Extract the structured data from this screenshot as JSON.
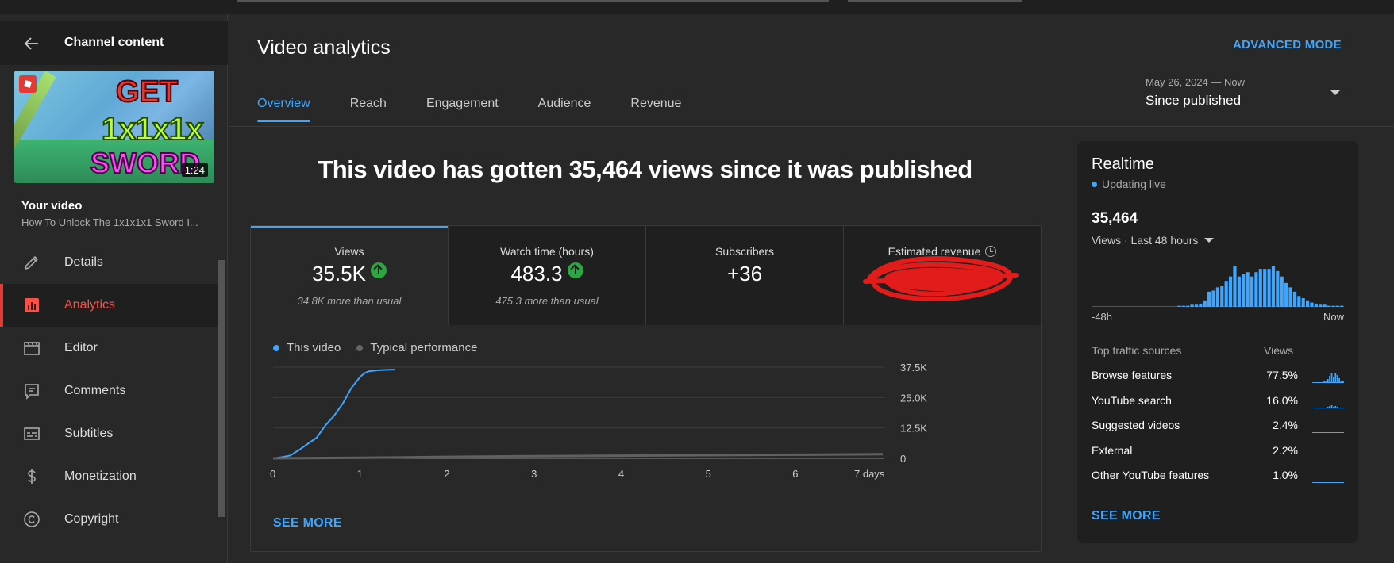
{
  "sidebar": {
    "title": "Channel content",
    "thumbnail": {
      "text_line1": "GET",
      "text_line2": "1x1x1x",
      "text_line3": "SWORD",
      "duration": "1:24"
    },
    "your_video_label": "Your video",
    "video_title": "How To Unlock The 1x1x1x1 Sword I...",
    "items": [
      {
        "label": "Details",
        "icon": "pencil-icon"
      },
      {
        "label": "Analytics",
        "icon": "analytics-icon",
        "active": true
      },
      {
        "label": "Editor",
        "icon": "clapperboard-icon"
      },
      {
        "label": "Comments",
        "icon": "comment-icon"
      },
      {
        "label": "Subtitles",
        "icon": "subtitles-icon"
      },
      {
        "label": "Monetization",
        "icon": "dollar-icon"
      },
      {
        "label": "Copyright",
        "icon": "copyright-icon"
      }
    ]
  },
  "header": {
    "title": "Video analytics",
    "advanced_mode": "ADVANCED MODE",
    "tabs": [
      "Overview",
      "Reach",
      "Engagement",
      "Audience",
      "Revenue"
    ],
    "date_range": "May 26, 2024 — Now",
    "date_label": "Since published"
  },
  "headline": "This video has gotten 35,464 views since it was published",
  "metrics": [
    {
      "label": "Views",
      "value": "35.5K",
      "note": "34.8K more than usual",
      "trend": "up"
    },
    {
      "label": "Watch time (hours)",
      "value": "483.3",
      "note": "475.3 more than usual",
      "trend": "up"
    },
    {
      "label": "Subscribers",
      "value": "+36",
      "note": ""
    },
    {
      "label": "Estimated revenue",
      "value": "",
      "note": "",
      "redacted": true
    }
  ],
  "chart_legend": {
    "this_video": "This video",
    "typical": "Typical performance"
  },
  "chart_data": {
    "type": "line",
    "x_ticks": [
      "0",
      "1",
      "2",
      "3",
      "4",
      "5",
      "6",
      "7 days"
    ],
    "y_ticks": [
      "37.5K",
      "25.0K",
      "12.5K",
      "0"
    ],
    "xlim": [
      0,
      7
    ],
    "ylim": [
      0,
      37500
    ],
    "series": [
      {
        "name": "This video",
        "color": "#3ea6ff",
        "x": [
          0,
          0.1,
          0.2,
          0.3,
          0.4,
          0.5,
          0.6,
          0.7,
          0.8,
          0.9,
          1.0,
          1.05,
          1.1,
          1.2,
          1.3,
          1.4
        ],
        "y": [
          0,
          500,
          1200,
          3500,
          6000,
          8500,
          13500,
          17500,
          22500,
          29000,
          33500,
          35000,
          35800,
          36200,
          36400,
          36500
        ]
      },
      {
        "name": "Typical performance",
        "color": "#606060",
        "x": [
          0,
          1,
          2,
          3,
          4,
          5,
          6,
          7
        ],
        "y": [
          0,
          250,
          600,
          900,
          1100,
          1300,
          1500,
          1700
        ]
      }
    ]
  },
  "see_more": "SEE MORE",
  "realtime": {
    "title": "Realtime",
    "status": "Updating live",
    "count": "35,464",
    "period": "Views · Last 48 hours",
    "axis_left": "-48h",
    "axis_right": "Now",
    "hourly_views": [
      0,
      0,
      0,
      0,
      0,
      0,
      0,
      0,
      0,
      0,
      0,
      0,
      0,
      0,
      0,
      0,
      0,
      0,
      0,
      0,
      1,
      1,
      1,
      2,
      2,
      3,
      6,
      14,
      15,
      18,
      19,
      24,
      28,
      38,
      28,
      30,
      32,
      28,
      32,
      35,
      35,
      35,
      38,
      33,
      28,
      22,
      18,
      14,
      10,
      8,
      6,
      4,
      3,
      2,
      2,
      1,
      1,
      1,
      1
    ],
    "col_sources": "Top traffic sources",
    "col_views": "Views",
    "sources": [
      {
        "name": "Browse features",
        "value": "77.5%"
      },
      {
        "name": "YouTube search",
        "value": "16.0%"
      },
      {
        "name": "Suggested videos",
        "value": "2.4%"
      },
      {
        "name": "External",
        "value": "2.2%"
      },
      {
        "name": "Other YouTube features",
        "value": "1.0%"
      }
    ],
    "see_more": "SEE MORE"
  }
}
